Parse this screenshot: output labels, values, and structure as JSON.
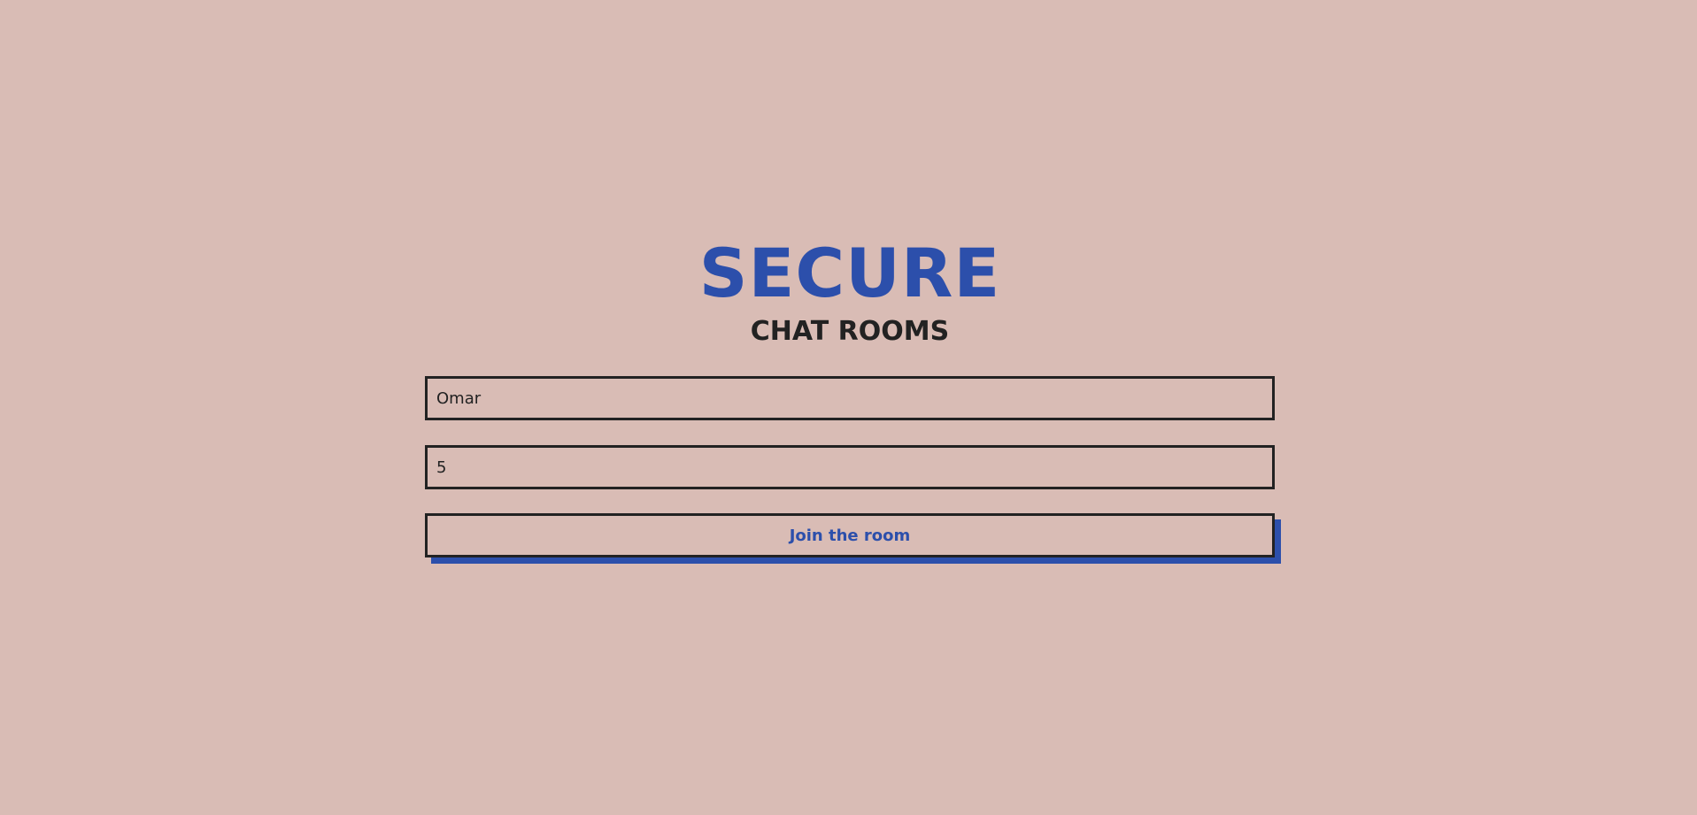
{
  "brand": {
    "title": "SECURE",
    "subtitle": "CHAT ROOMS"
  },
  "form": {
    "username_value": "Omar",
    "room_value": "5",
    "join_label": "Join the room"
  },
  "colors": {
    "background": "#d9bcb5",
    "accent": "#2c4fab",
    "text": "#222222"
  }
}
